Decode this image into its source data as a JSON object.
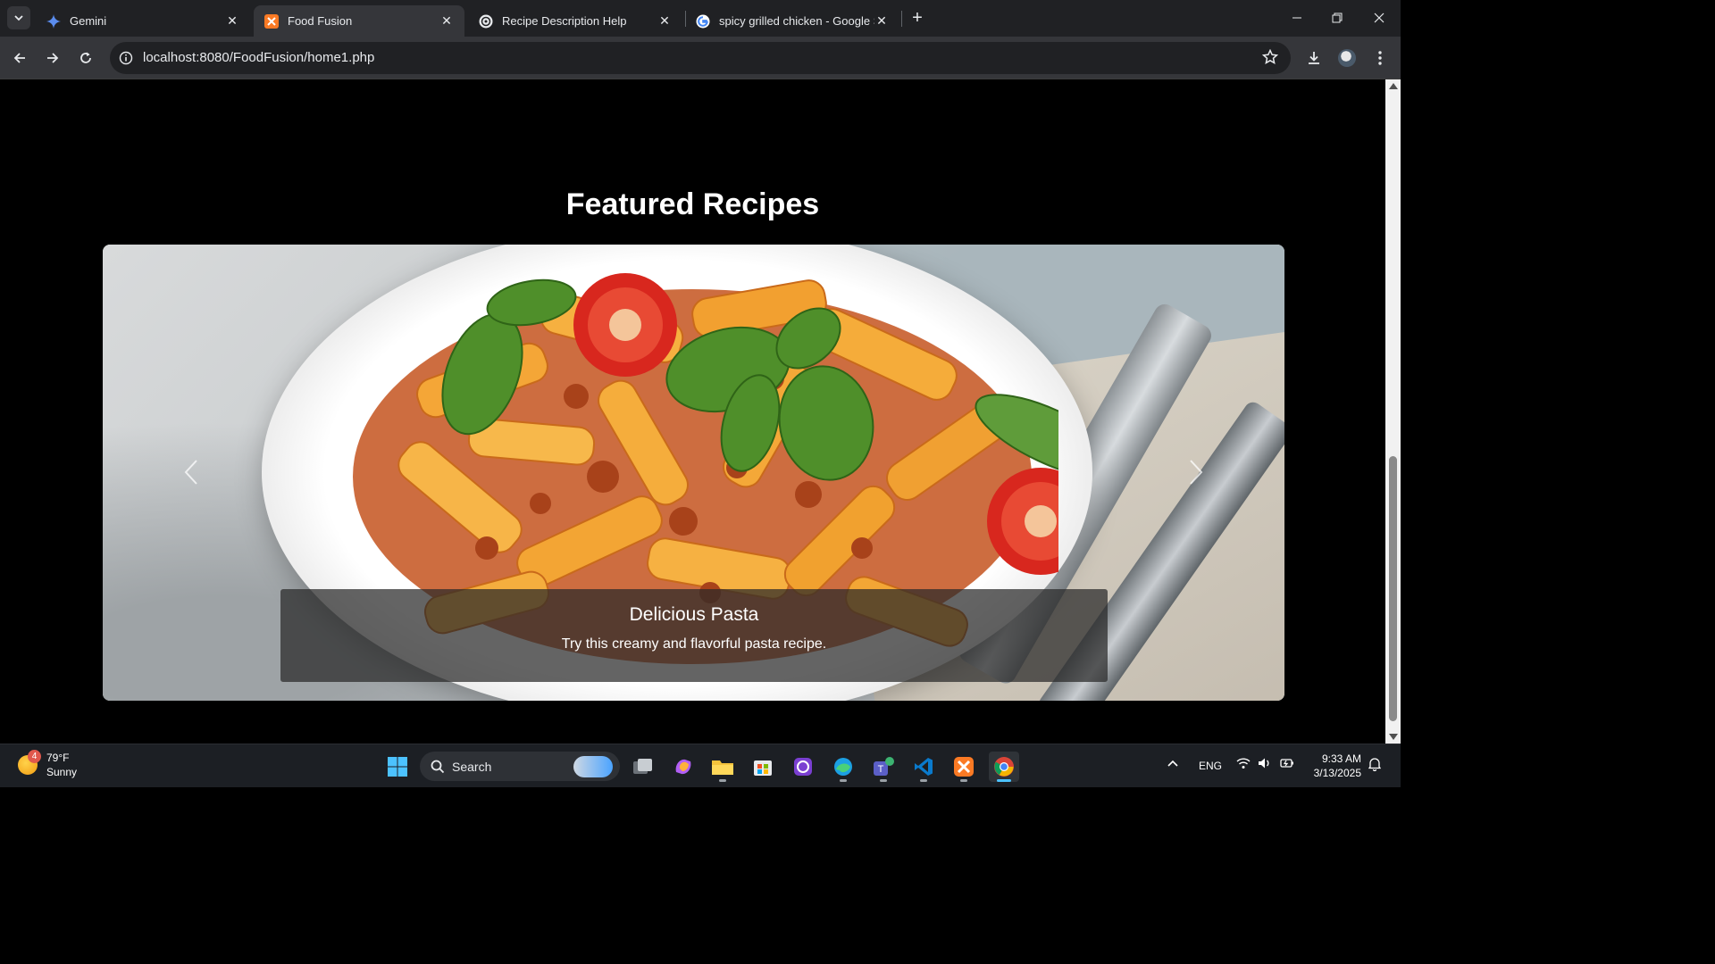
{
  "browser": {
    "tabs": [
      {
        "title": "Gemini",
        "active": false
      },
      {
        "title": "Food Fusion",
        "active": true
      },
      {
        "title": "Recipe Description Help",
        "active": false
      },
      {
        "title": "spicy grilled chicken - Google S",
        "active": false
      }
    ],
    "new_tab_label": "+",
    "url": "localhost:8080/FoodFusion/home1.php"
  },
  "page": {
    "section_title": "Featured Recipes",
    "carousel": {
      "active_slide": {
        "title": "Delicious Pasta",
        "description": "Try this creamy and flavorful pasta recipe."
      }
    }
  },
  "taskbar": {
    "weather": {
      "temp": "79°F",
      "condition": "Sunny",
      "badge": "4"
    },
    "search_label": "Search",
    "language": "ENG",
    "time": "9:33 AM",
    "date": "3/13/2025"
  },
  "colors": {
    "accent": "#4cc2ff",
    "chrome_bg": "#202124",
    "toolbar_bg": "#35363a"
  }
}
